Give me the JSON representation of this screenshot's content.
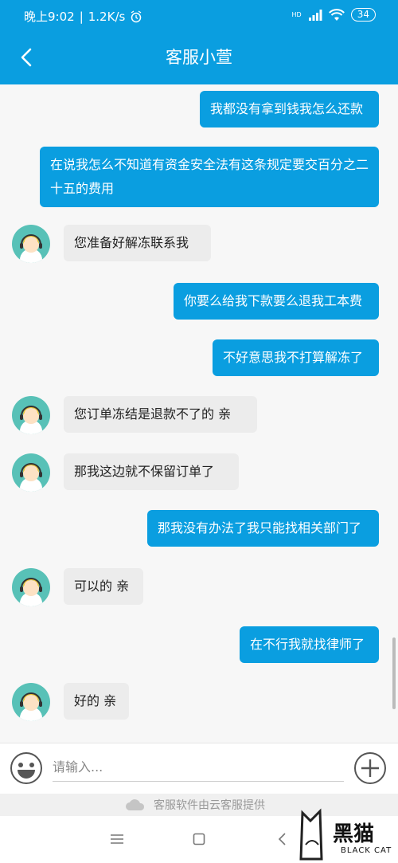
{
  "status": {
    "time": "晚上9:02",
    "speed": "1.2K/s",
    "signal": "HD",
    "battery": "34"
  },
  "header": {
    "title": "客服小萱"
  },
  "messages": [
    {
      "side": "out",
      "text": "我都没有拿到钱我怎么还款"
    },
    {
      "side": "out",
      "text": "在说我怎么不知道有资金安全法有这条规定要交百分之二十五的费用"
    },
    {
      "side": "in",
      "text": "您准备好解冻联系我"
    },
    {
      "side": "out",
      "text": "你要么给我下款要么退我工本费"
    },
    {
      "side": "out",
      "text": "不好意思我不打算解冻了"
    },
    {
      "side": "in",
      "text": "您订单冻结是退款不了的 亲"
    },
    {
      "side": "in",
      "text": "那我这边就不保留订单了"
    },
    {
      "side": "out",
      "text": "那我没有办法了我只能找相关部门了"
    },
    {
      "side": "in",
      "text": "可以的 亲"
    },
    {
      "side": "out",
      "text": "在不行我就找律师了"
    },
    {
      "side": "in",
      "text": "好的 亲"
    }
  ],
  "input": {
    "placeholder": "请输入..."
  },
  "footer": {
    "text": "客服软件由云客服提供"
  },
  "watermark": {
    "text": "黑猫",
    "sub": "BLACK CAT"
  },
  "colors": {
    "accent": "#0a9ee0",
    "bubble_in": "#ececec",
    "avatar_bg": "#58c1b7"
  }
}
